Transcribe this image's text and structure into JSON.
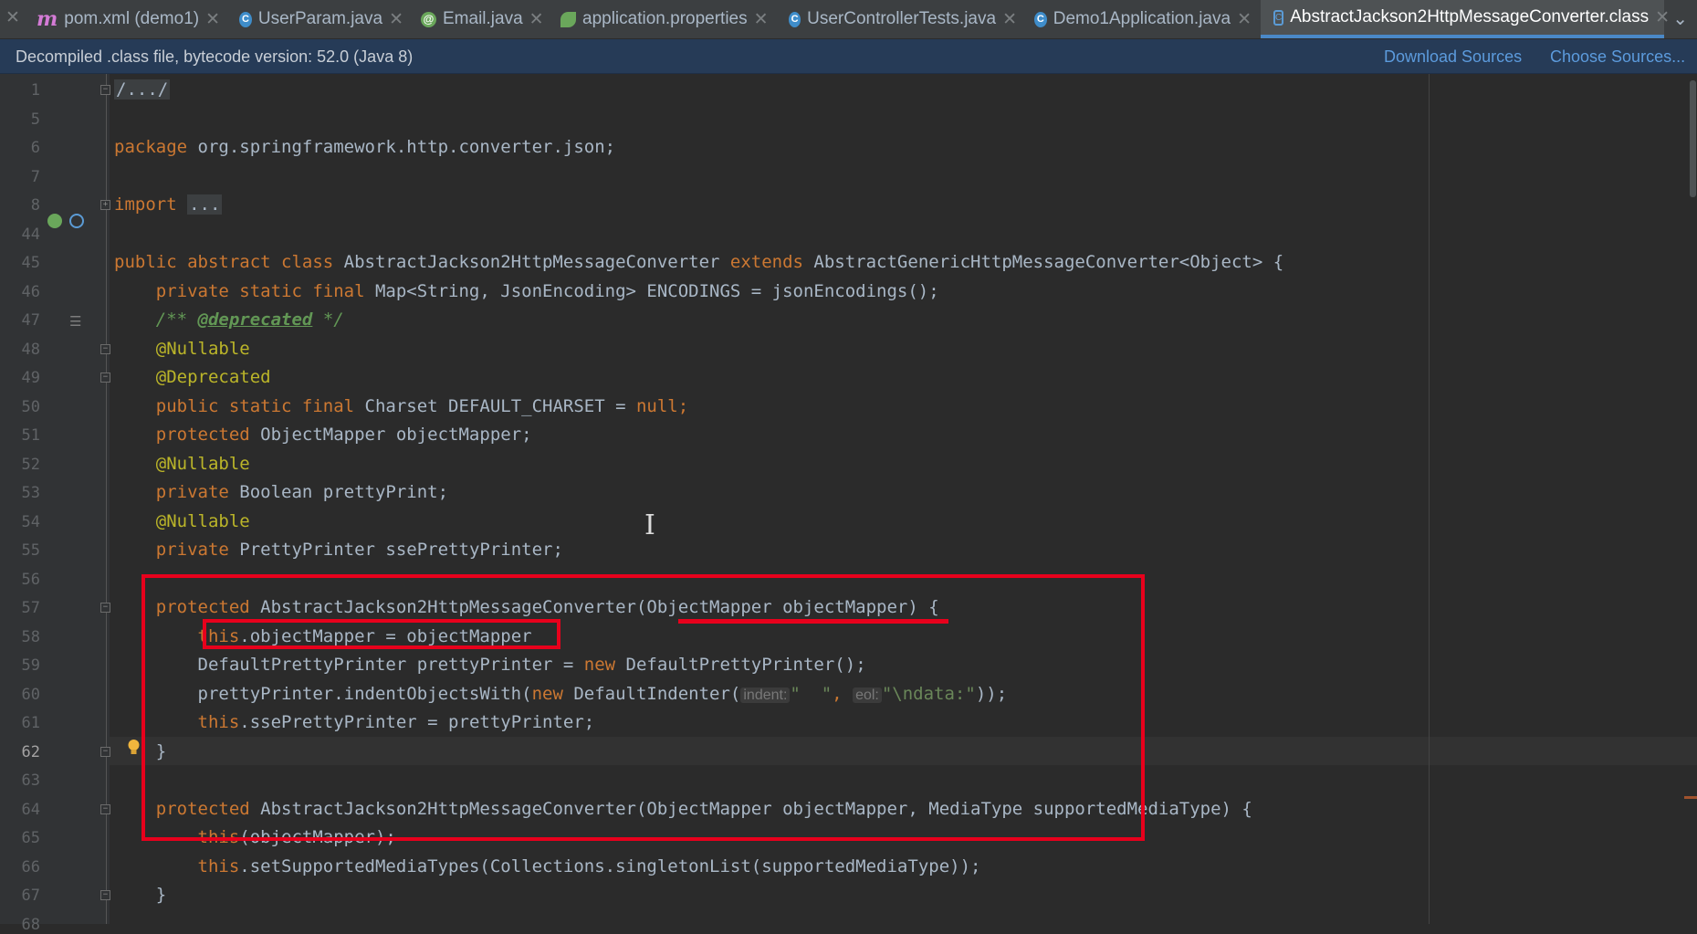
{
  "tabs": [
    {
      "label": "pom.xml (demo1)",
      "icon": "maven-icon",
      "active": false
    },
    {
      "label": "UserParam.java",
      "icon": "class-icon",
      "active": false
    },
    {
      "label": "Email.java",
      "icon": "annotation-icon",
      "active": false
    },
    {
      "label": "application.properties",
      "icon": "spring-properties-icon",
      "active": false
    },
    {
      "label": "UserControllerTests.java",
      "icon": "class-icon",
      "active": false
    },
    {
      "label": "Demo1Application.java",
      "icon": "spring-boot-class-icon",
      "active": false
    },
    {
      "label": "AbstractJackson2HttpMessageConverter.class",
      "icon": "compiled-class-icon",
      "active": true
    }
  ],
  "banner": {
    "text": "Decompiled .class file, bytecode version: 52.0 (Java 8)",
    "download_sources": "Download Sources",
    "choose_sources": "Choose Sources..."
  },
  "editor": {
    "current_line": "62",
    "line_numbers": [
      "1",
      "5",
      "6",
      "7",
      "8",
      "44",
      "45",
      "46",
      "47",
      "48",
      "49",
      "50",
      "51",
      "52",
      "53",
      "54",
      "55",
      "56",
      "57",
      "58",
      "59",
      "60",
      "61",
      "62",
      "63",
      "64",
      "65",
      "66",
      "67",
      "68"
    ],
    "code": {
      "l1": "/.../",
      "l6_kw": "package",
      "l6_rest": " org.springframework.http.converter.json;",
      "l8_kw": "import",
      "l8_ph": "...",
      "l45_kw1": "public abstract class",
      "l45_name": " AbstractJackson2HttpMessageConverter ",
      "l45_kw2": "extends",
      "l45_rest": " AbstractGenericHttpMessageConverter<Object> {",
      "l46_kw": "private static final",
      "l46_rest": " Map<String, JsonEncoding> ENCODINGS = jsonEncodings();",
      "l47_open": "/** ",
      "l47_tag": "@deprecated",
      "l47_close": " */",
      "l48": "@Nullable",
      "l49": "@Deprecated",
      "l50_kw": "public static final",
      "l50_rest": " Charset DEFAULT_CHARSET = ",
      "l50_null": "null",
      "l50_end": ";",
      "l51_kw": "protected",
      "l51_rest": " ObjectMapper objectMapper;",
      "l52": "@Nullable",
      "l53_kw": "private",
      "l53_rest": " Boolean prettyPrint;",
      "l54": "@Nullable",
      "l55_kw": "private",
      "l55_rest": " PrettyPrinter ssePrettyPrinter;",
      "l57_kw": "protected",
      "l57_rest": " AbstractJackson2HttpMessageConverter(ObjectMapper objectMapper) {",
      "l58_kw": "this",
      "l58_rest": ".objectMapper = objectMapper",
      "l59_a": "DefaultPrettyPrinter prettyPrinter = ",
      "l59_kw": "new",
      "l59_b": " DefaultPrettyPrinter();",
      "l60_a": "prettyPrinter.indentObjectsWith(",
      "l60_kw": "new",
      "l60_b": " DefaultIndenter(",
      "l60_hint1": "indent:",
      "l60_s1": "\"  \"",
      "l60_comma": ", ",
      "l60_hint2": "eol:",
      "l60_s2": "\"\\ndata:\"",
      "l60_end": "));",
      "l61_kw": "this",
      "l61_rest": ".ssePrettyPrinter = prettyPrinter;",
      "l62": "}",
      "l64_kw": "protected",
      "l64_rest": " AbstractJackson2HttpMessageConverter(ObjectMapper objectMapper, MediaType supportedMediaType) {",
      "l65_kw": "this",
      "l65_rest": "(objectMapper);",
      "l66_kw": "this",
      "l66_rest": ".setSupportedMediaTypes(Collections.singletonList(supportedMediaType));",
      "l67": "}"
    }
  },
  "colors": {
    "keyword": "#cc7832",
    "annotation": "#bbb529",
    "doc_comment": "#629755",
    "string": "#6a8759",
    "highlight_box": "#e8001c",
    "link": "#5c9bdd"
  }
}
